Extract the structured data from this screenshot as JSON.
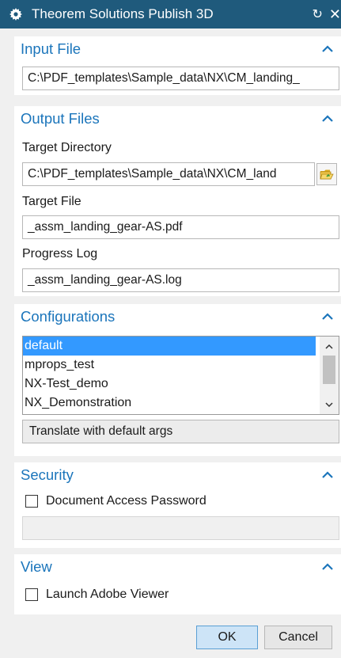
{
  "window": {
    "title": "Theorem Solutions Publish 3D"
  },
  "input_file": {
    "header": "Input File",
    "path": "C:\\PDF_templates\\Sample_data\\NX\\CM_landing_"
  },
  "output_files": {
    "header": "Output Files",
    "target_directory_label": "Target Directory",
    "target_directory_value": "C:\\PDF_templates\\Sample_data\\NX\\CM_land",
    "target_file_label": "Target File",
    "target_file_value": "_assm_landing_gear-AS.pdf",
    "progress_log_label": "Progress Log",
    "progress_log_value": "_assm_landing_gear-AS.log"
  },
  "configurations": {
    "header": "Configurations",
    "items": [
      {
        "label": "default",
        "selected": true
      },
      {
        "label": "mprops_test",
        "selected": false
      },
      {
        "label": "NX-Test_demo",
        "selected": false
      },
      {
        "label": "NX_Demonstration",
        "selected": false
      }
    ],
    "action_label": "Translate with default args"
  },
  "security": {
    "header": "Security",
    "password_checkbox_label": "Document Access Password",
    "password_checked": false
  },
  "view": {
    "header": "View",
    "launch_viewer_label": "Launch Adobe Viewer",
    "launch_checked": false
  },
  "footer": {
    "ok_label": "OK",
    "cancel_label": "Cancel"
  },
  "colors": {
    "titlebar": "#1f5a7c",
    "section_header_text": "#1b75bb",
    "selection": "#3399ff"
  }
}
